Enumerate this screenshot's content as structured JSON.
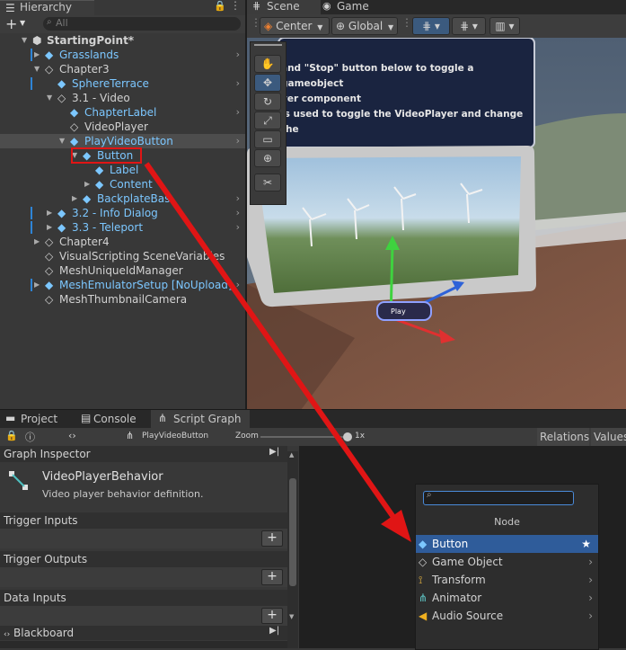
{
  "hierarchy": {
    "tab_label": "Hierarchy",
    "search_placeholder": "All",
    "items": [
      {
        "label": "StartingPoint*",
        "depth": 0,
        "expanded": true,
        "bold": true,
        "blue": false
      },
      {
        "label": "Grasslands",
        "depth": 1,
        "expanded": false,
        "blue": true,
        "chevron": true
      },
      {
        "label": "Chapter3",
        "depth": 1,
        "expanded": true,
        "blue": false
      },
      {
        "label": "SphereTerrace",
        "depth": 2,
        "expanded": null,
        "blue": true,
        "chevron": true
      },
      {
        "label": "3.1 - Video",
        "depth": 2,
        "expanded": true,
        "blue": false
      },
      {
        "label": "ChapterLabel",
        "depth": 3,
        "expanded": null,
        "blue": true,
        "chevron": true
      },
      {
        "label": "VideoPlayer",
        "depth": 3,
        "expanded": null,
        "blue": false
      },
      {
        "label": "PlayVideoButton",
        "depth": 3,
        "expanded": true,
        "blue": true,
        "chevron": true,
        "selected": true
      },
      {
        "label": "Button",
        "depth": 4,
        "expanded": true,
        "blue": true,
        "boxed": true
      },
      {
        "label": "Label",
        "depth": 5,
        "expanded": null,
        "blue": true
      },
      {
        "label": "Content",
        "depth": 5,
        "expanded": false,
        "blue": true
      },
      {
        "label": "BackplateBas",
        "depth": 4,
        "expanded": false,
        "blue": true,
        "chevron": true
      },
      {
        "label": "3.2 - Info Dialog",
        "depth": 2,
        "expanded": false,
        "blue": true,
        "chevron": true
      },
      {
        "label": "3.3 - Teleport",
        "depth": 2,
        "expanded": false,
        "blue": true,
        "chevron": true
      },
      {
        "label": "Chapter4",
        "depth": 1,
        "expanded": false,
        "blue": false
      },
      {
        "label": "VisualScripting SceneVariables",
        "depth": 1,
        "expanded": null,
        "blue": false
      },
      {
        "label": "MeshUniqueIdManager",
        "depth": 1,
        "expanded": null,
        "blue": false
      },
      {
        "label": "MeshEmulatorSetup [NoUpload]",
        "depth": 1,
        "expanded": false,
        "blue": true,
        "chevron": true
      },
      {
        "label": "MeshThumbnailCamera",
        "depth": 1,
        "expanded": null,
        "blue": false
      }
    ]
  },
  "scene": {
    "tabs": [
      "Scene",
      "Game"
    ],
    "pivot_label": "Center",
    "space_label": "Global",
    "info_text_1": "and \"Stop\" button below to toggle a gameobject",
    "info_text_2": "yer component",
    "info_text_3": "is used to toggle the VideoPlayer and change the",
    "button_label": "Play"
  },
  "bottom": {
    "tabs": [
      "Project",
      "Console",
      "Script Graph"
    ],
    "graph_name": "PlayVideoButton",
    "zoom_label": "Zoom",
    "zoom_value": "1x",
    "right_tabs": [
      "Relations",
      "Values"
    ]
  },
  "inspector": {
    "title": "Graph Inspector",
    "graph_title": "VideoPlayerBehavior",
    "graph_desc": "Video player behavior definition.",
    "sections": [
      "Trigger Inputs",
      "Trigger Outputs",
      "Data Inputs"
    ],
    "blackboard": "Blackboard"
  },
  "node_menu": {
    "search_value": "",
    "header": "Node",
    "items": [
      {
        "label": "Button",
        "icon": "cube-icon",
        "highlighted": true,
        "star": true
      },
      {
        "label": "Game Object",
        "icon": "cube-outline-icon",
        "submenu": true
      },
      {
        "label": "Transform",
        "icon": "transform-icon",
        "submenu": true
      },
      {
        "label": "Animator",
        "icon": "animator-icon",
        "submenu": true
      },
      {
        "label": "Audio Source",
        "icon": "audio-icon",
        "submenu": true
      }
    ]
  },
  "colors": {
    "selection_blue": "#2f5c9a",
    "prefab_blue": "#7cc7ff",
    "annotation_red": "#e01515"
  }
}
